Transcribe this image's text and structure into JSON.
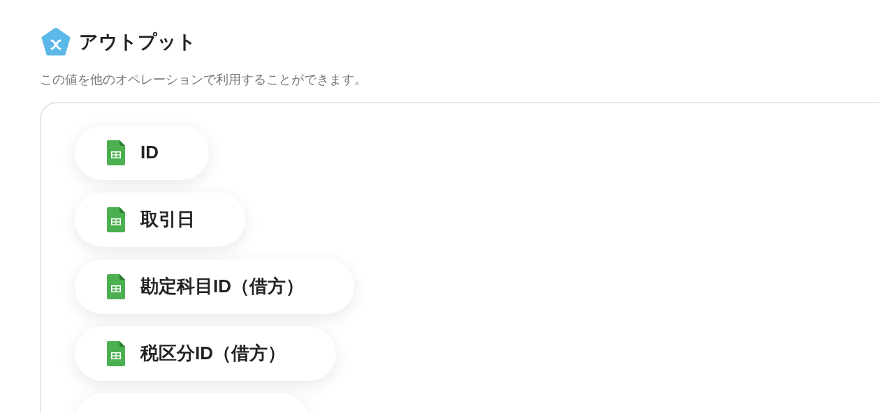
{
  "header": {
    "title": "アウトプット",
    "description": "この値を他のオペレーションで利用することができます。"
  },
  "outputs": [
    {
      "label": "ID"
    },
    {
      "label": "取引日"
    },
    {
      "label": "勘定科目ID（借方）"
    },
    {
      "label": "税区分ID（借方）"
    }
  ],
  "more_below": true
}
